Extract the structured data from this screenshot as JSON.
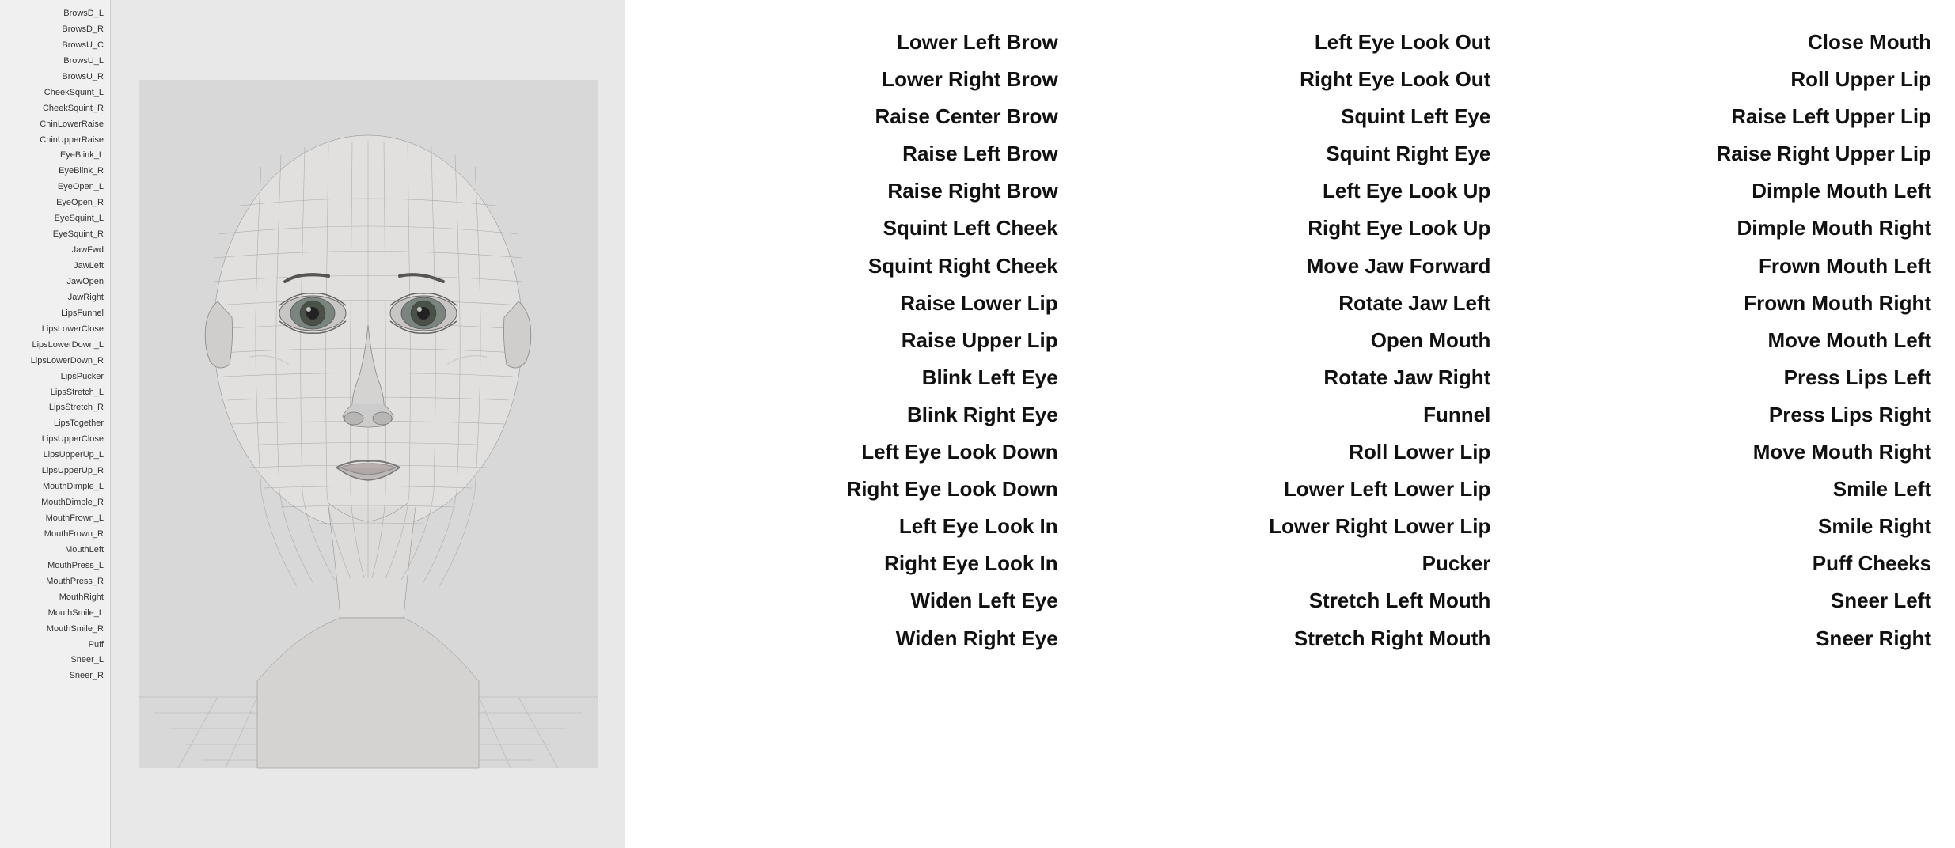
{
  "leftPanel": {
    "params": [
      "BrowsD_L",
      "BrowsD_R",
      "BrowsU_C",
      "BrowsU_L",
      "BrowsU_R",
      "CheekSquint_L",
      "CheekSquint_R",
      "ChinLowerRaise",
      "ChinUpperRaise",
      "EyeBlink_L",
      "EyeBlink_R",
      "EyeOpen_L",
      "EyeOpen_R",
      "EyeSquint_L",
      "EyeSquint_R",
      "JawFwd",
      "JawLeft",
      "JawOpen",
      "JawRight",
      "LipsFunnel",
      "LipsLowerClose",
      "LipsLowerDown_L",
      "LipsLowerDown_R",
      "LipsPucker",
      "LipsStretch_L",
      "LipsStretch_R",
      "LipsTogether",
      "LipsUpperClose",
      "LipsUpperUp_L",
      "LipsUpperUp_R",
      "MouthDimple_L",
      "MouthDimple_R",
      "MouthFrown_L",
      "MouthFrown_R",
      "MouthLeft",
      "MouthPress_L",
      "MouthPress_R",
      "MouthRight",
      "MouthSmile_L",
      "MouthSmile_R",
      "Puff",
      "Sneer_L",
      "Sneer_R"
    ]
  },
  "columns": {
    "col1": [
      "Lower Left Brow",
      "Lower Right Brow",
      "Raise Center Brow",
      "Raise Left Brow",
      "Raise Right Brow",
      "Squint Left Cheek",
      "Squint Right Cheek",
      "Raise Lower Lip",
      "Raise Upper Lip",
      "Blink Left Eye",
      "Blink Right Eye",
      "Left Eye Look Down",
      "Right Eye Look Down",
      "Left Eye Look In",
      "Right Eye Look In",
      "Widen Left Eye",
      "Widen Right Eye"
    ],
    "col2": [
      "Left Eye Look Out",
      "Right Eye Look Out",
      "Squint Left Eye",
      "Squint Right Eye",
      "Left Eye Look Up",
      "Right Eye Look Up",
      "Move Jaw Forward",
      "Rotate Jaw Left",
      "Open Mouth",
      "Rotate Jaw Right",
      "Funnel",
      "Roll Lower Lip",
      "Lower Left Lower Lip",
      "Lower Right Lower Lip",
      "Pucker",
      "Stretch Left Mouth",
      "Stretch Right Mouth"
    ],
    "col3": [
      "Close Mouth",
      "Roll Upper Lip",
      "Raise Left Upper Lip",
      "Raise Right Upper Lip",
      "Dimple Mouth Left",
      "Dimple Mouth Right",
      "Frown Mouth Left",
      "Frown Mouth Right",
      "Move Mouth Left",
      "Press Lips Left",
      "Press Lips Right",
      "Move Mouth Right",
      "Smile Left",
      "Smile Right",
      "Puff Cheeks",
      "Sneer Left",
      "Sneer Right"
    ]
  }
}
